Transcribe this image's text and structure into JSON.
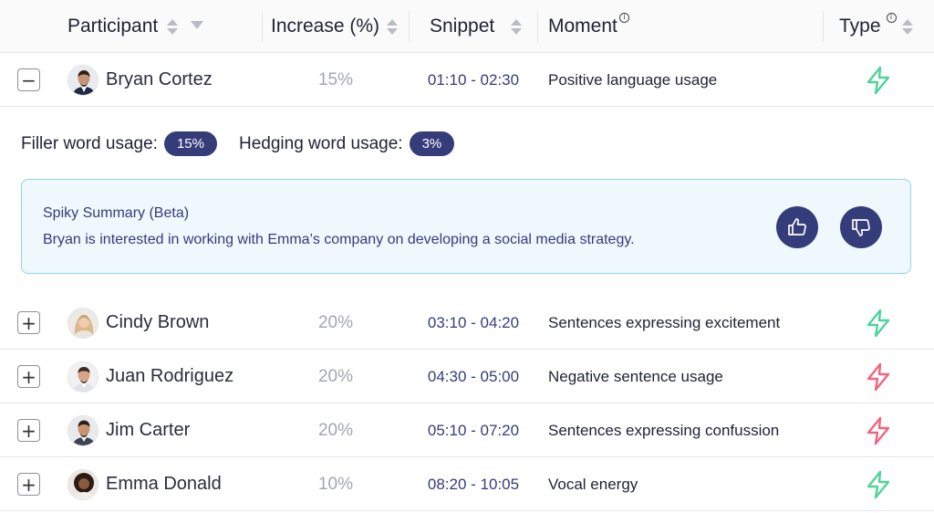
{
  "header": {
    "participant": "Participant",
    "increase": "Increase (%)",
    "snippet": "Snippet",
    "moment": "Moment",
    "type": "Type",
    "info_glyph": "i"
  },
  "rows": [
    {
      "name": "Bryan Cortez",
      "increase": "15%",
      "snippet": "01:10 - 02:30",
      "moment": "Positive language usage",
      "type_icon": "lightning-icon",
      "type_color": "#4ed39b",
      "toggle": "−",
      "expanded": true
    },
    {
      "name": "Cindy Brown",
      "increase": "20%",
      "snippet": "03:10 - 04:20",
      "moment": "Sentences expressing excitement",
      "type_icon": "lightning-icon",
      "type_color": "#4ed39b",
      "toggle": "+"
    },
    {
      "name": "Juan Rodriguez",
      "increase": "20%",
      "snippet": "04:30 - 05:00",
      "moment": "Negative sentence usage",
      "type_icon": "lightning-icon",
      "type_color": "#f0657f",
      "toggle": "+"
    },
    {
      "name": "Jim Carter",
      "increase": "20%",
      "snippet": "05:10 - 07:20",
      "moment": "Sentences expressing confussion",
      "type_icon": "lightning-icon",
      "type_color": "#f0657f",
      "toggle": "+"
    },
    {
      "name": "Emma Donald",
      "increase": "10%",
      "snippet": "08:20 - 10:05",
      "moment": "Vocal energy",
      "type_icon": "lightning-icon",
      "type_color": "#4ed39b",
      "toggle": "+"
    }
  ],
  "details": {
    "filler_label": "Filler word usage:",
    "filler_value": "15%",
    "hedging_label": "Hedging word usage:",
    "hedging_value": "3%",
    "summary_title": "Spiky Summary (Beta)",
    "summary_text": "Bryan is interested in working with Emma’s company on developing a social media strategy."
  },
  "colors": {
    "accent": "#353c7a",
    "positive": "#4ed39b",
    "negative": "#f0657f",
    "summary_bg": "#eef8fd",
    "summary_border": "#8ed5f1"
  }
}
